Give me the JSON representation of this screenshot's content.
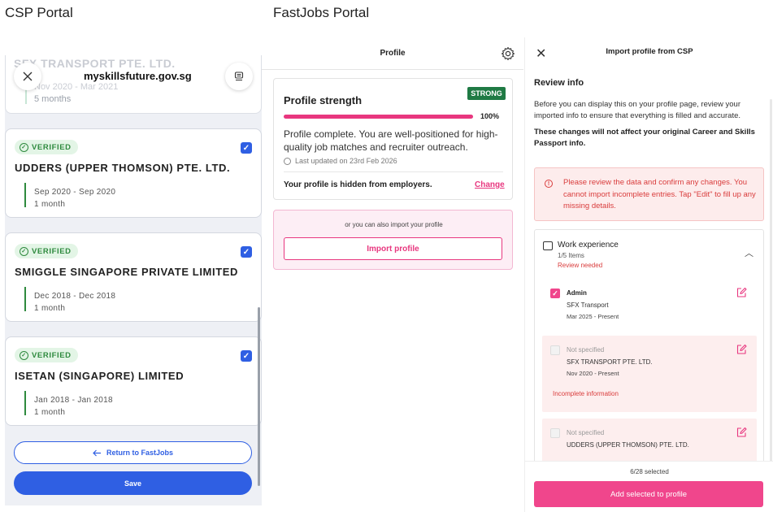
{
  "captions": {
    "left": "CSP Portal",
    "right": "FastJobs Portal"
  },
  "csp": {
    "url": "myskillsfuture.gov.sg",
    "partial_card": {
      "company": "SFX TRANSPORT PTE. LTD.",
      "dates": "Nov 2020 - Mar 2021",
      "duration": "5 months"
    },
    "verified_label": "VERIFIED",
    "entries": [
      {
        "company": "UDDERS (UPPER THOMSON) PTE. LTD.",
        "dates": "Sep 2020 - Sep 2020",
        "duration": "1 month",
        "checked": true
      },
      {
        "company": "SMIGGLE SINGAPORE PRIVATE LIMITED",
        "dates": "Dec 2018 - Dec 2018",
        "duration": "1 month",
        "checked": true
      },
      {
        "company": "ISETAN (SINGAPORE) LIMITED",
        "dates": "Jan 2018 - Jan 2018",
        "duration": "1 month",
        "checked": true
      }
    ],
    "return_label": "Return to FastJobs",
    "save_label": "Save",
    "accent": "#2f5fe3",
    "verified_color": "#2e8a3e"
  },
  "profile": {
    "header_title": "Profile",
    "strength_title": "Profile strength",
    "strength_badge": "STRONG",
    "strength_percent": "100%",
    "strength_fraction": 1.0,
    "description": "Profile complete. You are well-positioned for high-quality job matches and recruiter outreach.",
    "last_updated": "Last updated on 23rd Feb 2026",
    "hidden_text": "Your profile is hidden from employers.",
    "change_label": "Change",
    "import_hint": "or you can also import your profile",
    "import_label": "Import profile",
    "accent": "#e8377f",
    "badge_color": "#1f7a44"
  },
  "import_csp": {
    "title": "Import profile from CSP",
    "review_heading": "Review info",
    "review_text": "Before you can display this on your profile page, review your imported info to ensure that everything is filled and accurate.",
    "review_bold": "These changes will not affect your original Career and Skills Passport info.",
    "alert_text": "Please review the data and confirm any changes. You cannot import incomplete entries. Tap \"Edit\" to fill up any missing details.",
    "section_title": "Work experience",
    "section_count": "1/5 Items",
    "section_status": "Review needed",
    "jobs": [
      {
        "title": "Admin",
        "company": "SFX Transport",
        "dates": "Mar 2025 - Present",
        "checked": true,
        "incomplete": ""
      },
      {
        "title": "Not specified",
        "company": "SFX TRANSPORT PTE. LTD.",
        "dates": "Nov 2020 - Present",
        "checked": false,
        "incomplete": "Incomplete information"
      },
      {
        "title": "Not specified",
        "company": "UDDERS (UPPER THOMSON) PTE. LTD.",
        "dates": "",
        "checked": false,
        "incomplete": ""
      }
    ],
    "selected_count": "6/28 selected",
    "add_label": "Add selected to profile",
    "alert_color": "#d93c3c",
    "button_color": "#f0468c"
  }
}
